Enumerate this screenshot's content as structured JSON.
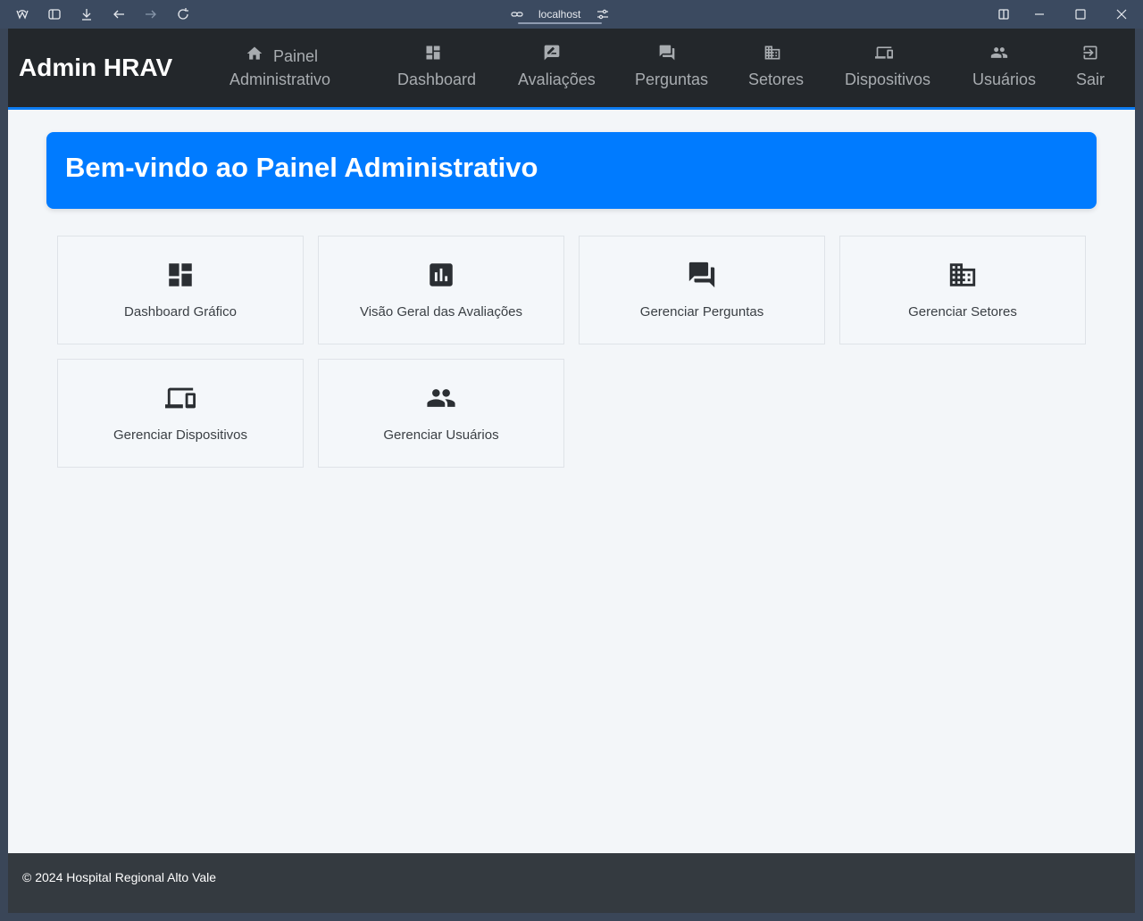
{
  "browser": {
    "url": "localhost"
  },
  "navbar": {
    "brand": "Admin HRAV",
    "items": [
      {
        "label_line1": "Painel",
        "label_line2": "Administrativo",
        "icon": "home-icon"
      },
      {
        "label": "Dashboard",
        "icon": "dashboard-icon"
      },
      {
        "label": "Avaliações",
        "icon": "rate-review-icon"
      },
      {
        "label": "Perguntas",
        "icon": "forum-icon"
      },
      {
        "label": "Setores",
        "icon": "business-icon"
      },
      {
        "label": "Dispositivos",
        "icon": "devices-icon"
      },
      {
        "label": "Usuários",
        "icon": "people-icon"
      },
      {
        "label": "Sair",
        "icon": "exit-icon"
      }
    ]
  },
  "hero": {
    "title": "Bem-vindo ao Painel Administrativo"
  },
  "cards": [
    {
      "label": "Dashboard Gráfico",
      "icon": "dashboard-icon"
    },
    {
      "label": "Visão Geral das Avaliações",
      "icon": "assessment-icon"
    },
    {
      "label": "Gerenciar Perguntas",
      "icon": "forum-icon"
    },
    {
      "label": "Gerenciar Setores",
      "icon": "business-icon"
    },
    {
      "label": "Gerenciar Dispositivos",
      "icon": "devices-icon"
    },
    {
      "label": "Gerenciar Usuários",
      "icon": "people-icon"
    }
  ],
  "footer": {
    "text": "© 2024 Hospital Regional Alto Vale"
  },
  "colors": {
    "navbar": "#23272b",
    "accent": "#007bff",
    "footer": "#343a40",
    "page_bg": "#f3f6f9"
  }
}
